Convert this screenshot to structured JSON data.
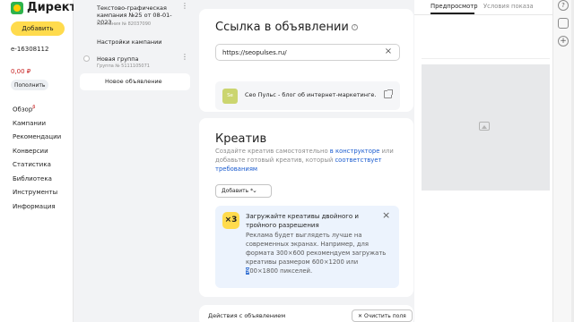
{
  "nav": {
    "logo_text": "Директ",
    "add_label": "Добавить",
    "login": "e-16308112",
    "balance": "0,00 ₽",
    "topup_label": "Пополнить",
    "items": [
      {
        "label": "Обзор",
        "badge": "β"
      },
      {
        "label": "Кампании"
      },
      {
        "label": "Рекомендации"
      },
      {
        "label": "Конверсии"
      },
      {
        "label": "Статистика"
      },
      {
        "label": "Библиотека"
      },
      {
        "label": "Инструменты"
      },
      {
        "label": "Информация"
      }
    ]
  },
  "tree": {
    "campaign_title": "Текстово-графическая кампания №25 от 08-01-2023",
    "campaign_number": "Кампания № 82037090",
    "campaign_settings": "Настройки кампании",
    "group_name": "Новая группа",
    "group_number": "Группа № 5111105071",
    "new_ad": "Новое объявление"
  },
  "link_card": {
    "title": "Ссылка в объявлении",
    "url_value": "https://seopulses.ru/",
    "favicon_text": "Se",
    "preview_title": "Сео Пульс - блог об интернет-маркетинге."
  },
  "creative_card": {
    "title": "Креатив",
    "desc_part1": "Создайте креатив самостоятельно ",
    "desc_link1": "в конструкторе",
    "desc_part2": " или добавьте готовый креатив, который ",
    "desc_link2": "соответствует требованиям",
    "add_label": "Добавить *",
    "tip": {
      "badge": "×3",
      "title": "Загружайте креативы двойного и тройного разрешения",
      "body_before": "Реклама будет выглядеть лучше на современных экранах. Например, для формата 300×600 рекомендуем загружать креативы размером 600×1200 или ",
      "body_highlight": "9",
      "body_after": "00×1800 пикселей."
    }
  },
  "actions_card": {
    "label": "Действия с объявлением",
    "clear_label": "Очистить поля"
  },
  "right_panel": {
    "tab_preview": "Предпросмотр",
    "tab_conditions": "Условия показа"
  },
  "strip": {
    "help_glyph": "?",
    "plus_glyph": "+"
  },
  "colors": {
    "accent_yellow": "#ffdb4d",
    "link_blue": "#1a5bcf",
    "balance_red": "#c71f1f",
    "tip_bg": "#ecf3fd"
  }
}
